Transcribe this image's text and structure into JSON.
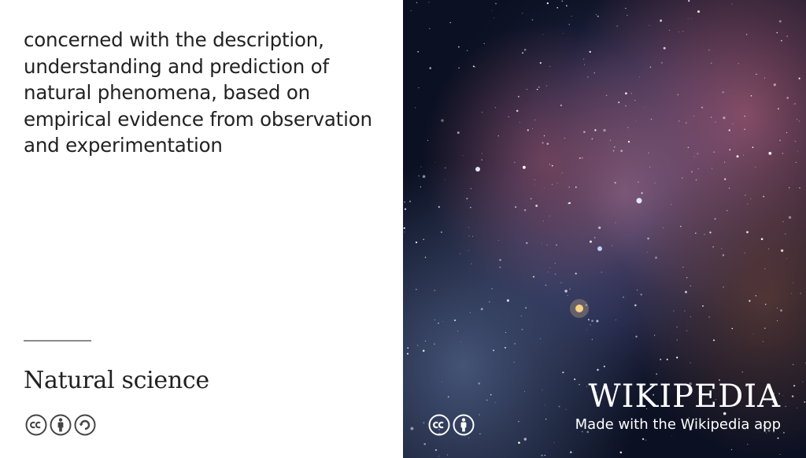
{
  "article": {
    "excerpt": "concerned with the description, understanding and prediction of natural phenomena, based on empirical evidence from observation and experimentation",
    "title": "Natural science"
  },
  "license_icons_left": [
    "cc-icon",
    "by-attribution-icon",
    "share-alike-icon"
  ],
  "license_icons_right": [
    "cc-icon",
    "by-attribution-icon"
  ],
  "branding": {
    "wordmark": "WIKIPEDIA",
    "tagline": "Made with the Wikipedia app"
  },
  "image": {
    "subject": "nebula star field"
  },
  "colors": {
    "text": "#222222",
    "divider": "#8a8a8a",
    "overlay_text": "#ffffff"
  }
}
